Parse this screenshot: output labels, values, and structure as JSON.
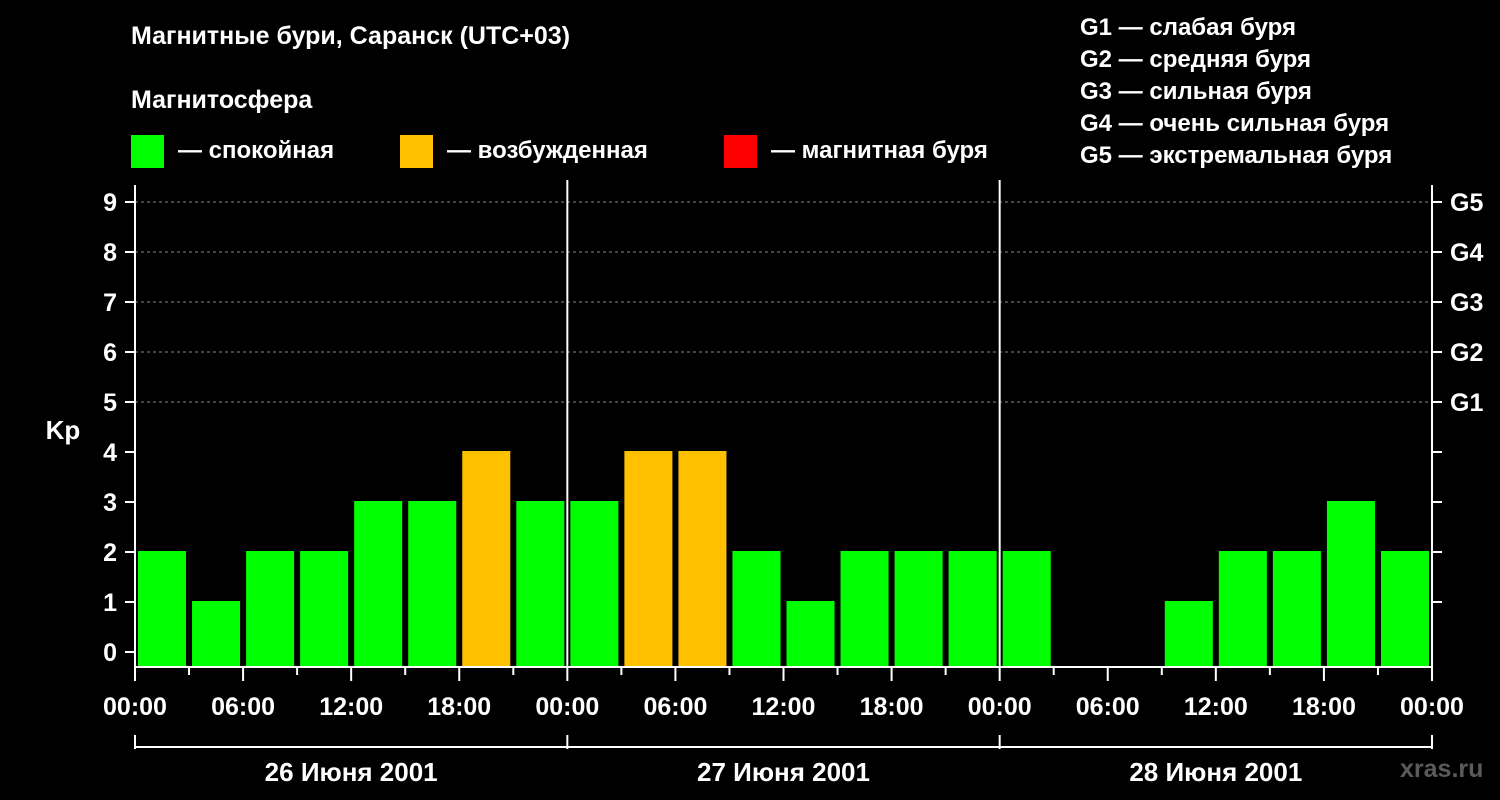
{
  "header": {
    "title": "Магнитные бури, Саранск (UTC+03)",
    "subtitle": "Магнитосфера"
  },
  "legend": [
    {
      "color": "#00ff00",
      "label": "— спокойная"
    },
    {
      "color": "#ffc000",
      "label": "— возбужденная"
    },
    {
      "color": "#ff0000",
      "label": "— магнитная буря"
    }
  ],
  "g_levels": [
    "G1 — слабая буря",
    "G2 — средняя буря",
    "G3 — сильная буря",
    "G4 — очень сильная буря",
    "G5 — экстремальная буря"
  ],
  "watermark": "xras.ru",
  "chart_data": {
    "type": "bar",
    "ylabel": "Kp",
    "ylim": [
      0,
      9
    ],
    "yticks": [
      "0",
      "1",
      "2",
      "3",
      "4",
      "5",
      "6",
      "7",
      "8",
      "9"
    ],
    "right_ticks": [
      {
        "value": 5,
        "label": "G1"
      },
      {
        "value": 6,
        "label": "G2"
      },
      {
        "value": 7,
        "label": "G3"
      },
      {
        "value": 8,
        "label": "G4"
      },
      {
        "value": 9,
        "label": "G5"
      }
    ],
    "xticks": [
      "00:00",
      "06:00",
      "12:00",
      "18:00",
      "00:00",
      "06:00",
      "12:00",
      "18:00",
      "00:00",
      "06:00",
      "12:00",
      "18:00",
      "00:00"
    ],
    "days": [
      "26 Июня 2001",
      "27 Июня 2001",
      "28 Июня 2001"
    ],
    "interval_hours": 3,
    "grid": true,
    "values": [
      2,
      1,
      2,
      2,
      3,
      3,
      4,
      3,
      3,
      4,
      4,
      2,
      1,
      2,
      2,
      2,
      2,
      null,
      null,
      1,
      2,
      2,
      3,
      2
    ],
    "colors": {
      "quiet": "#00ff00",
      "active": "#ffc000",
      "storm": "#ff0000"
    }
  }
}
